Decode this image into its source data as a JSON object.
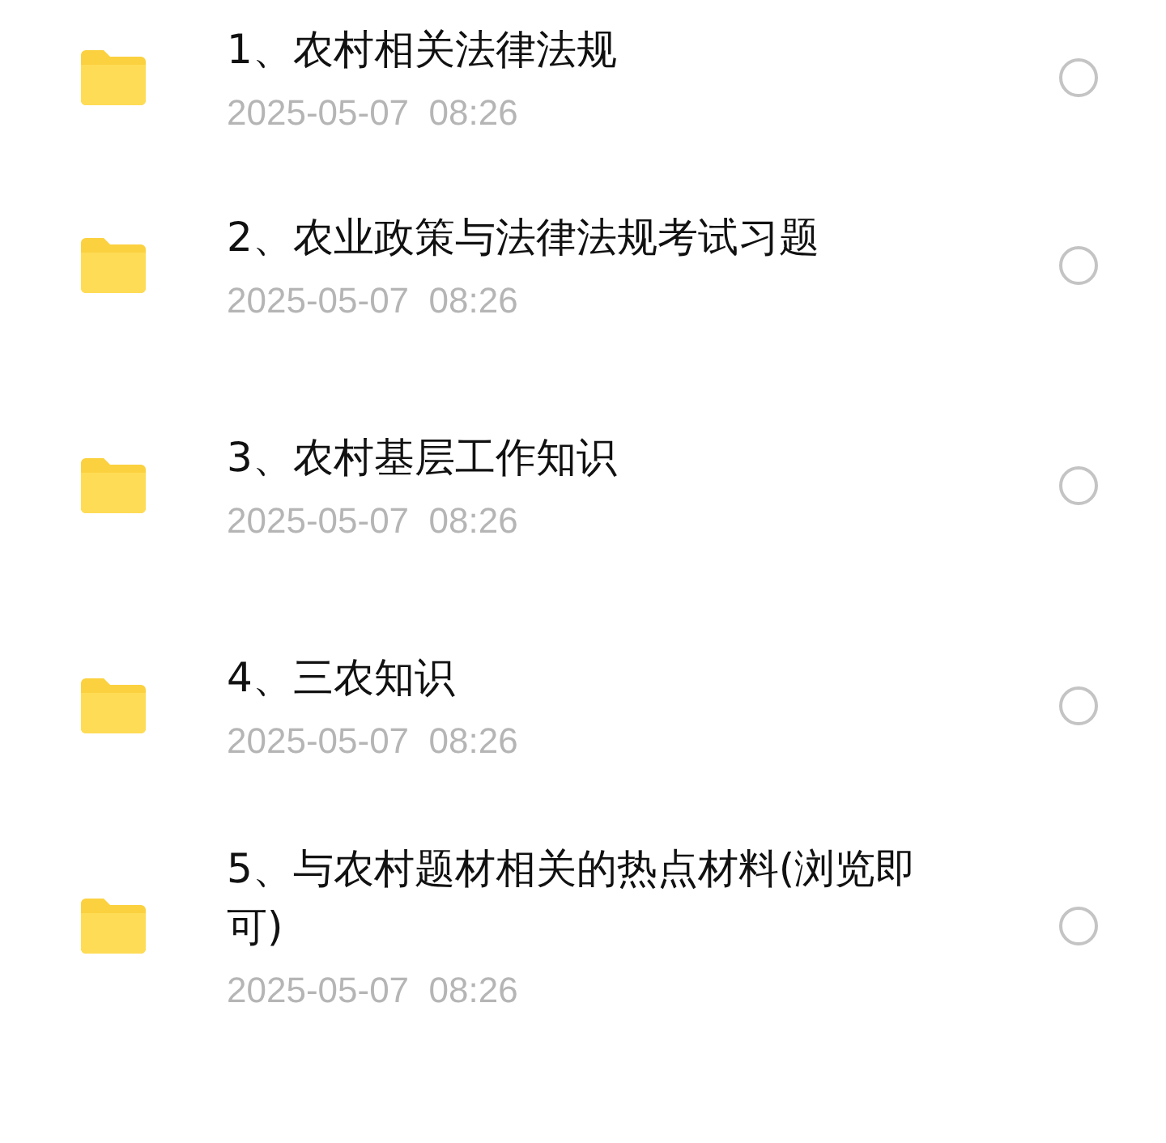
{
  "files": [
    {
      "name": "1、农村相关法律法规",
      "date": "2025-05-07  08:26",
      "selected": false
    },
    {
      "name": "2、农业政策与法律法规考试习题",
      "date": "2025-05-07  08:26",
      "selected": false
    },
    {
      "name": "3、农村基层工作知识",
      "date": "2025-05-07  08:26",
      "selected": false
    },
    {
      "name": "4、三农知识",
      "date": "2025-05-07  08:26",
      "selected": false
    },
    {
      "name": "5、与农村题材相关的热点材料(浏览即可)",
      "date": "2025-05-07  08:26",
      "selected": false
    }
  ]
}
